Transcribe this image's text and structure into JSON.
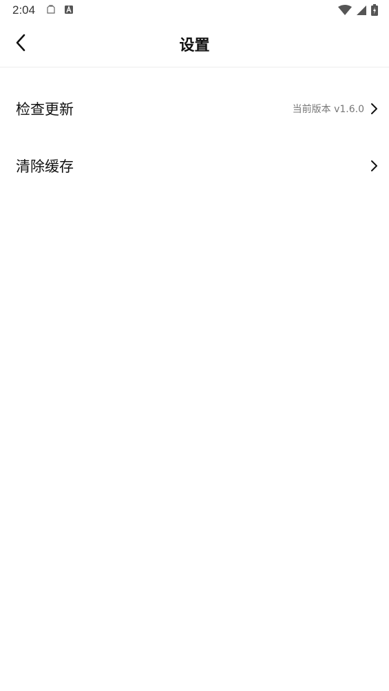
{
  "status_bar": {
    "time": "2:04",
    "notifications": [
      "clipboard-icon",
      "font-a-icon"
    ],
    "indicators": [
      "wifi-icon",
      "cellular-signal-icon",
      "battery-charging-icon"
    ]
  },
  "header": {
    "title": "设置",
    "back_icon": "chevron-left-icon"
  },
  "settings": {
    "items": [
      {
        "label": "检查更新",
        "value": "当前版本 v1.6.0",
        "icon": "chevron-right-icon"
      },
      {
        "label": "清除缓存",
        "value": "",
        "icon": "chevron-right-icon"
      }
    ]
  }
}
